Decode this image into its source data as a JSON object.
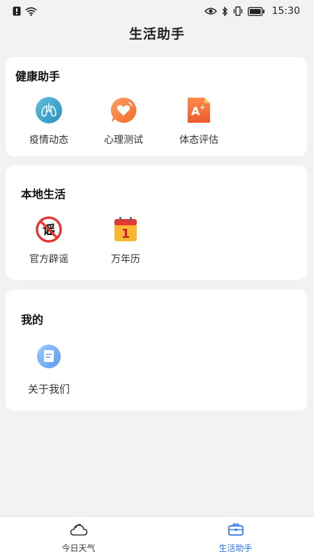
{
  "status_bar": {
    "time": "15:30",
    "icons": [
      "alert-icon",
      "wifi-icon",
      "eye-icon",
      "bluetooth-icon",
      "vibrate-icon",
      "battery-icon"
    ]
  },
  "page_title": "生活助手",
  "sections": {
    "health": {
      "title": "健康助手",
      "items": [
        {
          "label": "疫情动态",
          "icon": "lungs-icon"
        },
        {
          "label": "心理测试",
          "icon": "heart-chat-icon"
        },
        {
          "label": "体态评估",
          "icon": "grade-document-icon"
        }
      ]
    },
    "local": {
      "title": "本地生活",
      "items": [
        {
          "label": "官方辟谣",
          "icon": "no-rumor-icon",
          "icon_text": "谣"
        },
        {
          "label": "万年历",
          "icon": "calendar-icon",
          "icon_text": "1"
        }
      ]
    },
    "mine": {
      "title": "我的",
      "items": [
        {
          "label": "关于我们",
          "icon": "about-document-icon"
        }
      ]
    }
  },
  "tab_bar": {
    "tabs": [
      {
        "label": "今日天气",
        "icon": "weather-cloud-icon",
        "active": false
      },
      {
        "label": "生活助手",
        "icon": "briefcase-icon",
        "active": true
      }
    ]
  },
  "colors": {
    "accent": "#2f76e8",
    "background": "#f2f2f2",
    "card": "#ffffff"
  }
}
